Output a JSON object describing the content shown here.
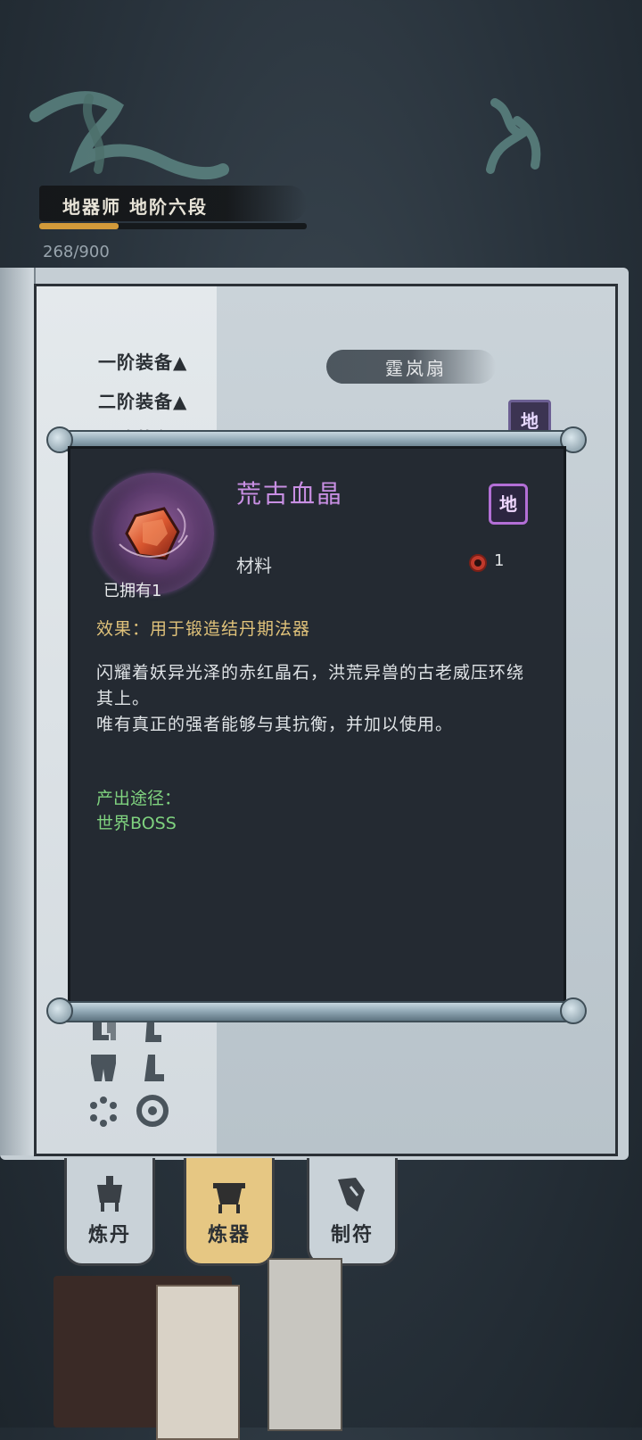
{
  "player": {
    "rank_title": "地器师 地阶六段",
    "exp_text": "268/900",
    "exp_progress": 0.298
  },
  "book": {
    "tiers": [
      "一阶装备▲",
      "二阶装备▲",
      "三阶装备▼"
    ],
    "selected_weapon": "霆岚扇",
    "grade_badge": "地"
  },
  "tabs": [
    {
      "label": "炼丹",
      "icon": "alchemy-cauldron-icon",
      "active": false
    },
    {
      "label": "炼器",
      "icon": "forge-cauldron-icon",
      "active": true
    },
    {
      "label": "制符",
      "icon": "talisman-icon",
      "active": false
    }
  ],
  "item_popup": {
    "name": "荒古血晶",
    "grade_badge": "地",
    "type": "材料",
    "cost_value": "1",
    "owned": "已拥有1",
    "effect": "效果：用于锻造结丹期法器",
    "description": "闪耀着妖异光泽的赤红晶石，洪荒异兽的古老威压环绕其上。\n唯有真正的强者能够与其抗衡，并加以使用。",
    "source_label": "产出途径：",
    "source_value": "世界BOSS"
  },
  "colors": {
    "item_name": "#c88fe3",
    "effect_text": "#e0c27a",
    "source_text": "#7fd27f",
    "exp_bar": "#d29a3a"
  }
}
